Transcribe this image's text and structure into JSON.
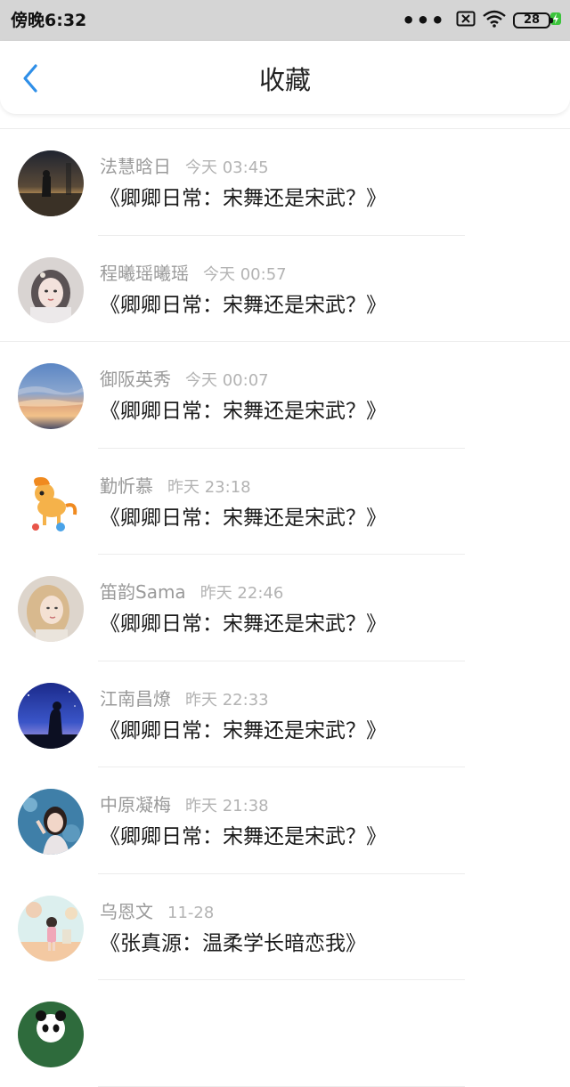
{
  "status_bar": {
    "time": "傍晚6:32",
    "battery_level": "28",
    "icons": [
      "more-dots-icon",
      "sim-card-x-icon",
      "wifi-icon",
      "battery-icon",
      "charging-bolt-icon"
    ]
  },
  "header": {
    "title": "收藏",
    "back_icon": "chevron-left-icon",
    "accent_color": "#2f8fe8"
  },
  "favorites": [
    {
      "user": "法慧晗日",
      "time": "今天 03:45",
      "title": "《卿卿日常：宋舞还是宋武？》",
      "avatar": "night-silhouette"
    },
    {
      "user": "程曦瑶曦瑶",
      "time": "今天 00:57",
      "title": "《卿卿日常：宋舞还是宋武？》",
      "avatar": "girl-with-hairpin"
    },
    {
      "user": "御阪英秀",
      "time": "今天 00:07",
      "title": "《卿卿日常：宋舞还是宋武？》",
      "avatar": "sunset-sky"
    },
    {
      "user": "勤忻慕",
      "time": "昨天 23:18",
      "title": "《卿卿日常：宋舞还是宋武？》",
      "avatar": "cartoon-pony"
    },
    {
      "user": "笛韵Sama",
      "time": "昨天 22:46",
      "title": "《卿卿日常：宋舞还是宋武？》",
      "avatar": "blonde-girl"
    },
    {
      "user": "江南昌燎",
      "time": "昨天 22:33",
      "title": "《卿卿日常：宋舞还是宋武？》",
      "avatar": "night-sky-silhouette"
    },
    {
      "user": "中原凝梅",
      "time": "昨天 21:38",
      "title": "《卿卿日常：宋舞还是宋武？》",
      "avatar": "girl-blue-background"
    },
    {
      "user": "乌恩文",
      "time": "11-28",
      "title": "《张真源：温柔学长暗恋我》",
      "avatar": "anime-girl-pastel"
    },
    {
      "user": "",
      "time": "",
      "title": "",
      "avatar": "panda-partial"
    }
  ]
}
